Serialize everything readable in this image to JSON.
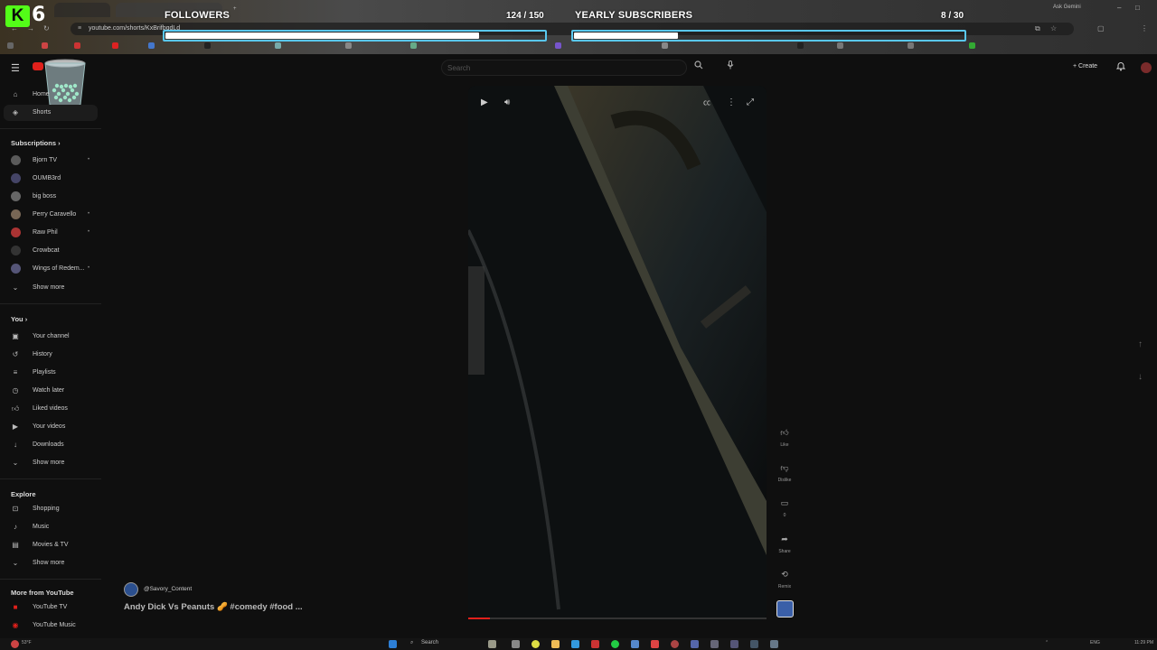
{
  "overlay": {
    "kick_count": "6",
    "followers": {
      "label": "FOLLOWERS",
      "count": "124 / 150",
      "progress": 0.827
    },
    "subscribers": {
      "label": "YEARLY SUBSCRIBERS",
      "count": "8 / 30",
      "progress": 0.267
    }
  },
  "browser": {
    "url": "youtube.com/shorts/KxBrifbqdLd",
    "ask_gemini": "Ask Gemini"
  },
  "topbar": {
    "search_placeholder": "Search",
    "create_label": "Create"
  },
  "sidebar": {
    "home": "Home",
    "shorts": "Shorts",
    "subscriptions_title": "Subscriptions",
    "subscriptions": [
      "Bjorn TV",
      "OUMB3rd",
      "big boss",
      "Perry Caravello",
      "Raw Phil",
      "Crowbcat",
      "Wings of Redem..."
    ],
    "show_more": "Show more",
    "you_title": "You",
    "you_items": [
      "Your channel",
      "History",
      "Playlists",
      "Watch later",
      "Liked videos",
      "Your videos",
      "Downloads"
    ],
    "explore_title": "Explore",
    "explore_items": [
      "Shopping",
      "Music",
      "Movies & TV"
    ],
    "more_title": "More from YouTube",
    "more_items": [
      "YouTube TV",
      "YouTube Music"
    ]
  },
  "short": {
    "channel": "@Savory_Content",
    "title": "Andy Dick Vs Peanuts 🥜 #comedy #food ..."
  },
  "actions": {
    "like": "Like",
    "dislike": "Dislike",
    "comments": "0",
    "share": "Share",
    "remix": "Remix"
  },
  "taskbar": {
    "search": "Search",
    "weather": "53°F",
    "lang": "ENG",
    "time": "11:29 PM"
  },
  "colors": {
    "kick_green": "#53fc18",
    "goal_border": "#59c7ef",
    "youtube_red": "#e0201b",
    "background": "#0f0f0f"
  }
}
